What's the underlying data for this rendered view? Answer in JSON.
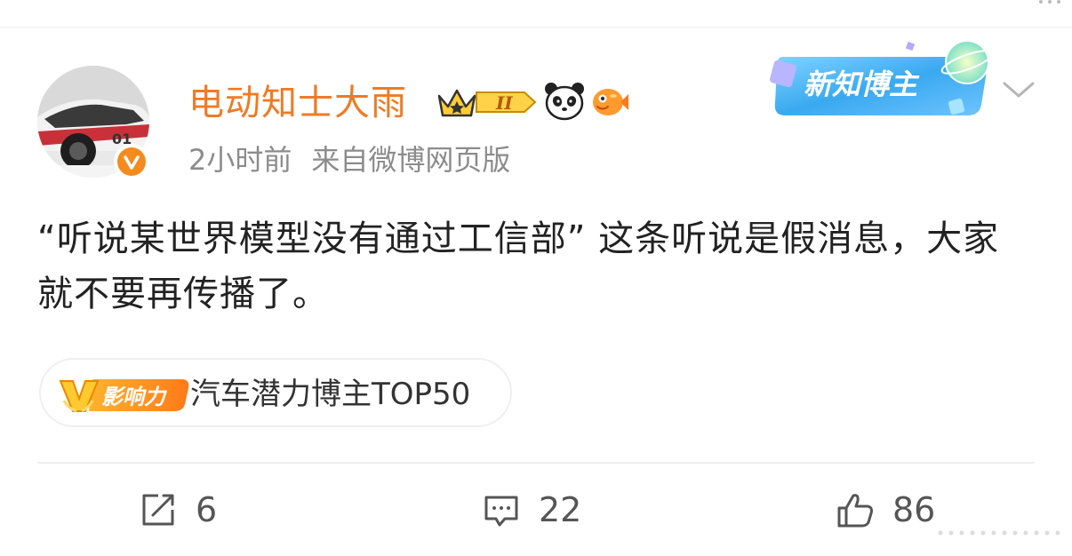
{
  "post": {
    "author": {
      "name": "电动知士大雨",
      "level_badge_text": "II"
    },
    "meta": {
      "time": "2小时前",
      "source": "来自微博网页版"
    },
    "blogger_tag": "新知博主",
    "content": "“听说某世界模型没有通过工信部” 这条听说是假消息，大家就不要再传播了。",
    "influence": {
      "badge_text": "影响力",
      "label": "汽车潜力博主TOP50"
    },
    "actions": {
      "repost_count": "6",
      "comment_count": "22",
      "like_count": "86"
    }
  },
  "colors": {
    "username": "#f07a24",
    "verified": "#f58b1f",
    "meta_text": "#8c8c8c",
    "body_text": "#222222",
    "icon_gray": "#555555"
  }
}
